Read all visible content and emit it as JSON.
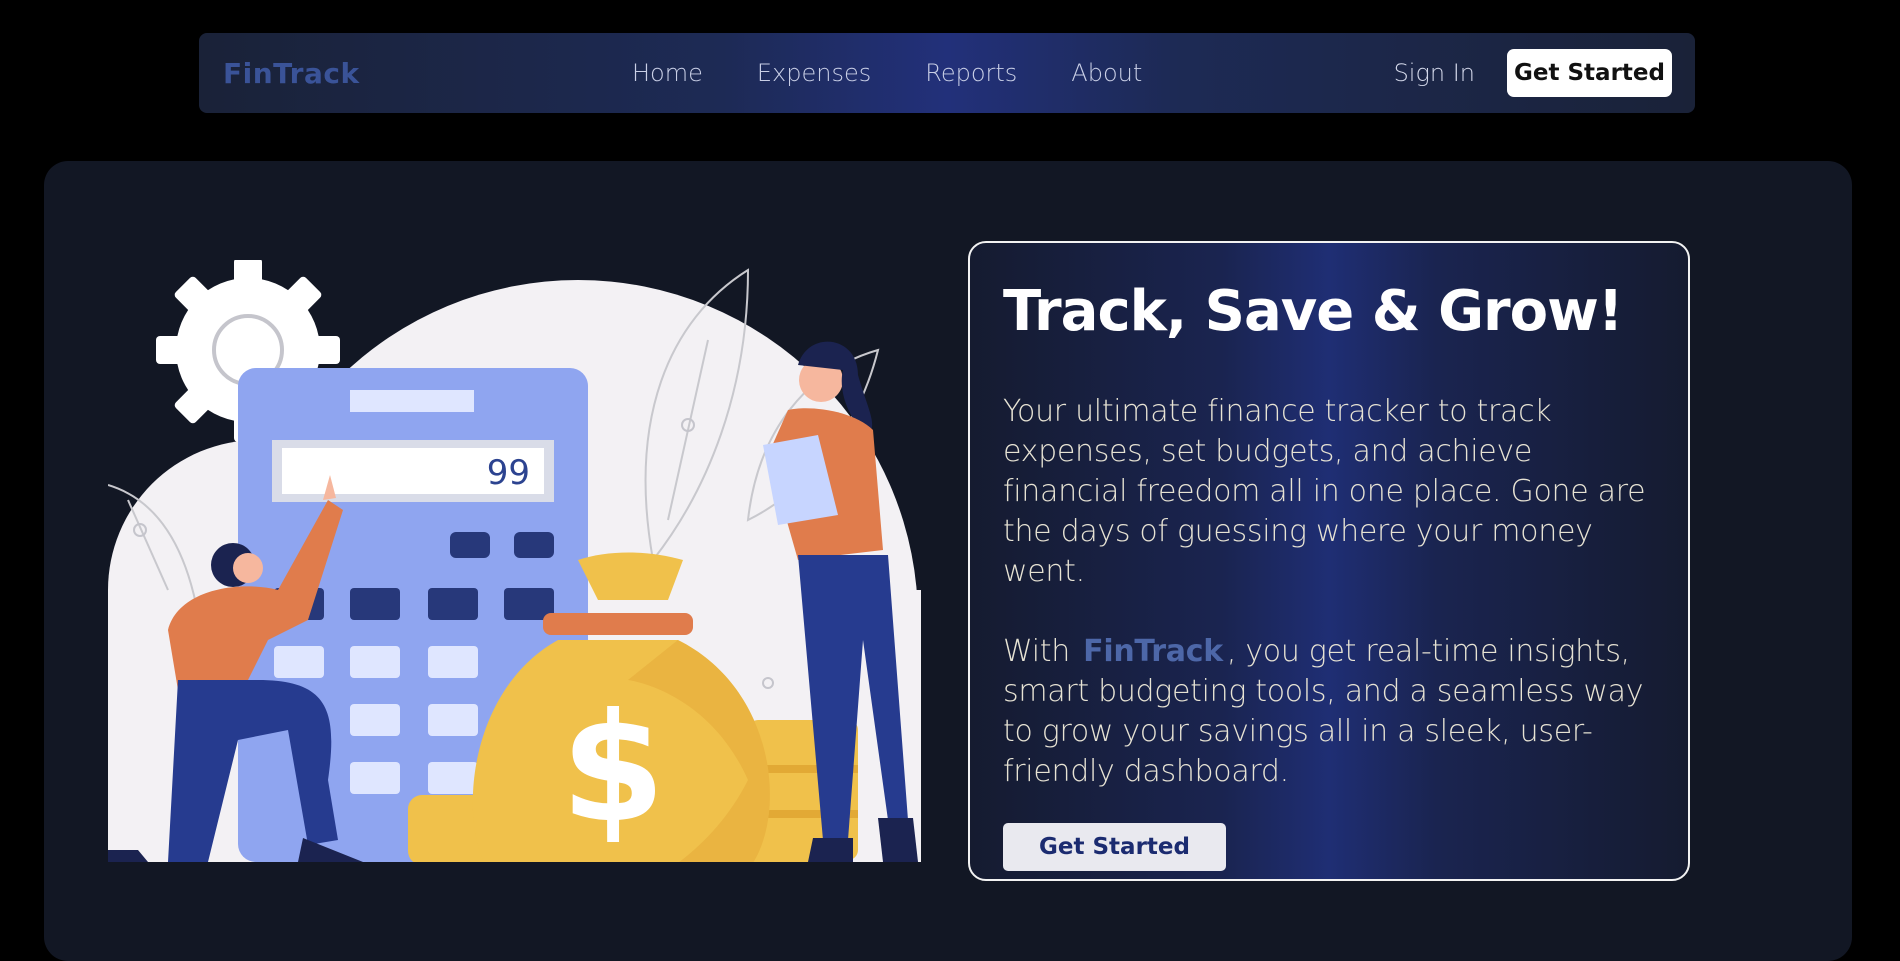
{
  "nav": {
    "brand": "FinTrack",
    "links": [
      "Home",
      "Expenses",
      "Reports",
      "About"
    ],
    "sign_in": "Sign In",
    "cta": "Get Started"
  },
  "hero": {
    "calculator_display": "99",
    "card": {
      "title": "Track, Save & Grow!",
      "paragraph1": "Your ultimate finance tracker to track expenses, set budgets, and achieve financial freedom all in one place. Gone are the days of guessing where your money went.",
      "paragraph2_prefix": "With",
      "paragraph2_brand": "FinTrack",
      "paragraph2_suffix": ", you get real-time insights, smart budgeting tools, and a seamless way to grow your savings all in a sleek, user-friendly dashboard.",
      "cta": "Get Started"
    }
  },
  "colors": {
    "page_bg": "#000000",
    "hero_bg": "#121724",
    "brand": "#3a5398",
    "accent_blue": "#1f2e74"
  }
}
